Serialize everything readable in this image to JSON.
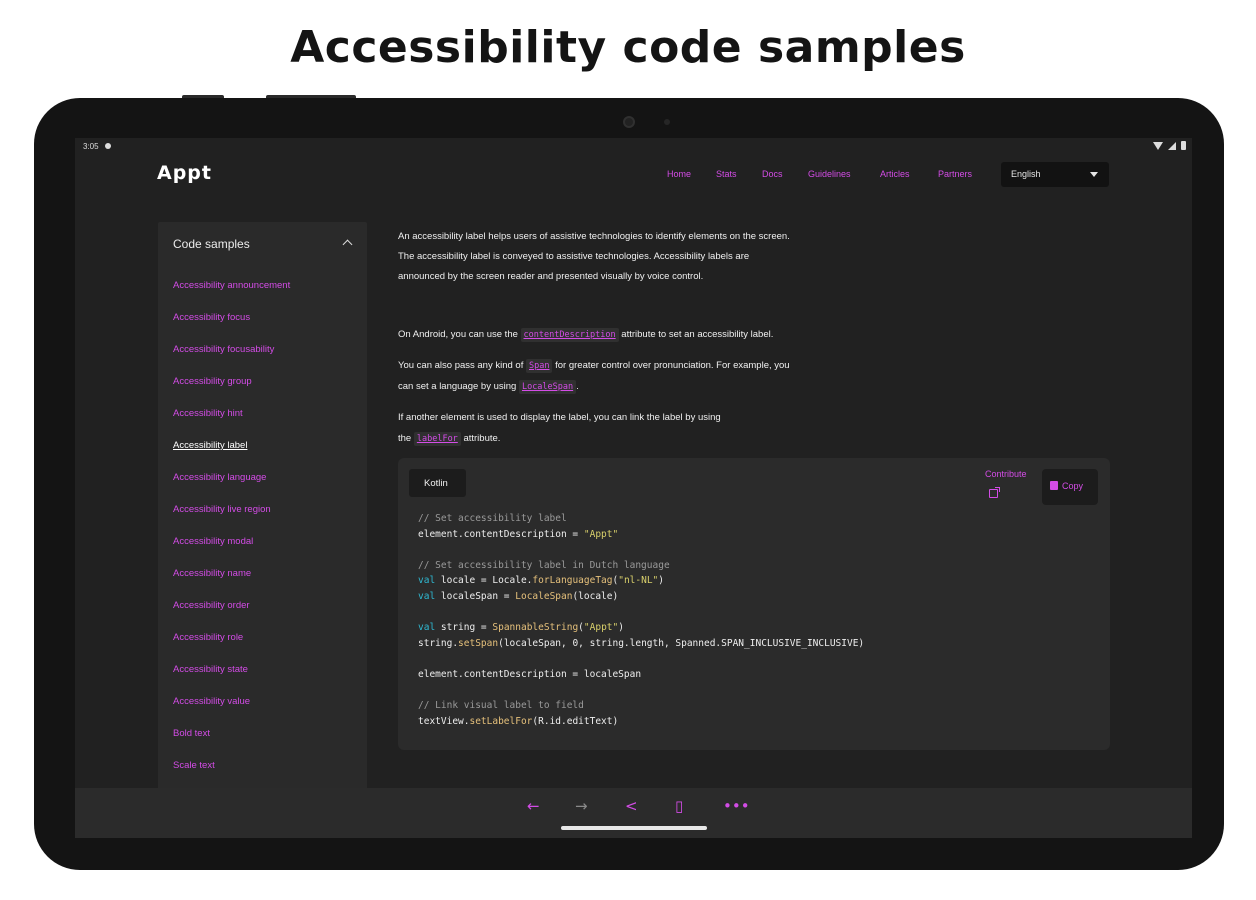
{
  "headline": "Accessibility code samples",
  "status": {
    "time": "3:05"
  },
  "logo": "Appt",
  "nav": [
    "Home",
    "Stats",
    "Docs",
    "Guidelines",
    "Articles",
    "Partners"
  ],
  "language_select": "English",
  "sidebar": {
    "title": "Code samples",
    "items": [
      "Accessibility announcement",
      "Accessibility focus",
      "Accessibility focusability",
      "Accessibility group",
      "Accessibility hint",
      "Accessibility label",
      "Accessibility language",
      "Accessibility live region",
      "Accessibility modal",
      "Accessibility name",
      "Accessibility order",
      "Accessibility role",
      "Accessibility state",
      "Accessibility value",
      "Bold text",
      "Scale text"
    ],
    "active_index": 5
  },
  "content": {
    "intro_lines": [
      "An accessibility label helps users of assistive technologies to identify elements on the screen.",
      "The accessibility label is conveyed to assistive technologies. Accessibility labels are",
      "announced by the screen reader and presented visually by voice control."
    ],
    "android_pre": "On Android, you can use the",
    "android_code": "contentDescription",
    "android_post": "attribute to set an accessibility label.",
    "span_pre": "You can also pass any kind of",
    "span_code": "Span",
    "span_post": "for greater control over pronunciation. For example, you",
    "locale_pre": "can set a language by using",
    "locale_code": "LocaleSpan",
    "locale_post": ".",
    "labelfor_line1": "If another element is used to display the label, you can link the label by using",
    "labelfor_pre": "the",
    "labelfor_code": "labelFor",
    "labelfor_post": "attribute."
  },
  "code_sample": {
    "language": "Kotlin",
    "contribute": "Contribute",
    "copy": "Copy",
    "comment1": "// Set accessibility label",
    "line1_a": "element.contentDescription = ",
    "line1_str": "\"Appt\"",
    "comment2": "// Set accessibility label in Dutch language",
    "line2_kw": "val",
    "line2_a": " locale = Locale.",
    "line2_fn": "forLanguageTag",
    "line2_b": "(",
    "line2_str": "\"nl-NL\"",
    "line2_c": ")",
    "line3_kw": "val",
    "line3_a": " localeSpan = ",
    "line3_fn": "LocaleSpan",
    "line3_b": "(locale)",
    "line4_kw": "val",
    "line4_a": " string = ",
    "line4_fn": "SpannableString",
    "line4_b": "(",
    "line4_str": "\"Appt\"",
    "line4_c": ")",
    "line5_a": "string.",
    "line5_fn": "setSpan",
    "line5_b": "(localeSpan, 0, string.length, Spanned.SPAN_INCLUSIVE_INCLUSIVE)",
    "line6": "element.contentDescription = localeSpan",
    "comment3": "// Link visual label to field",
    "line7_a": "textView.",
    "line7_fn": "setLabelFor",
    "line7_b": "(R.id.editText)"
  },
  "bottom_icons": [
    "back-arrow-icon",
    "forward-arrow-icon",
    "share-icon",
    "tabs-icon",
    "more-icon"
  ]
}
